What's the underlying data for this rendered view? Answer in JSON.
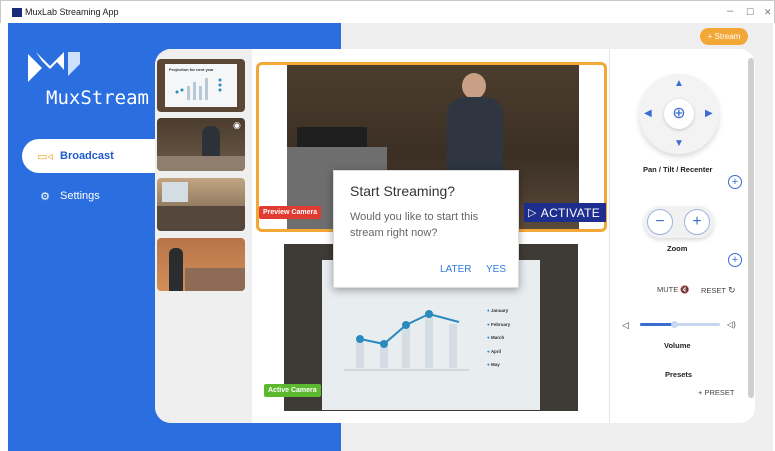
{
  "window": {
    "title": "MuxLab Streaming App",
    "minimize": "–",
    "maximize": "☐",
    "close": "✕"
  },
  "brand": {
    "name": "MuxStream"
  },
  "nav": [
    {
      "label": "Broadcast",
      "icon": "camera-icon",
      "active": true
    },
    {
      "label": "Settings",
      "icon": "gear-icon",
      "active": false
    }
  ],
  "header": {
    "stream_button": "+ Stream"
  },
  "thumbnails": [
    {
      "caption": "Projection for next year"
    },
    {
      "caption": ""
    },
    {
      "caption": ""
    },
    {
      "caption": ""
    }
  ],
  "preview": {
    "tag": "Preview Camera",
    "activate": "ACTIVATE",
    "color_tag": "#e23b32"
  },
  "active": {
    "tag": "Active Camera",
    "color_tag": "#5cb82e",
    "legend": [
      "January",
      "February",
      "March",
      "April",
      "May"
    ]
  },
  "dialog": {
    "title": "Start Streaming?",
    "message": "Would you like to start this stream right now?",
    "later": "LATER",
    "yes": "YES"
  },
  "controls": {
    "pan_label": "Pan / Tilt / Recenter",
    "zoom_label": "Zoom",
    "mute": "MUTE",
    "reset": "RESET",
    "volume_label": "Volume",
    "volume_level": 0.42,
    "presets_label": "Presets",
    "add_preset": "+ PRESET"
  },
  "colors": {
    "accent": "#2a6ee0",
    "orange": "#f3a736",
    "navy": "#1d2e8f"
  }
}
